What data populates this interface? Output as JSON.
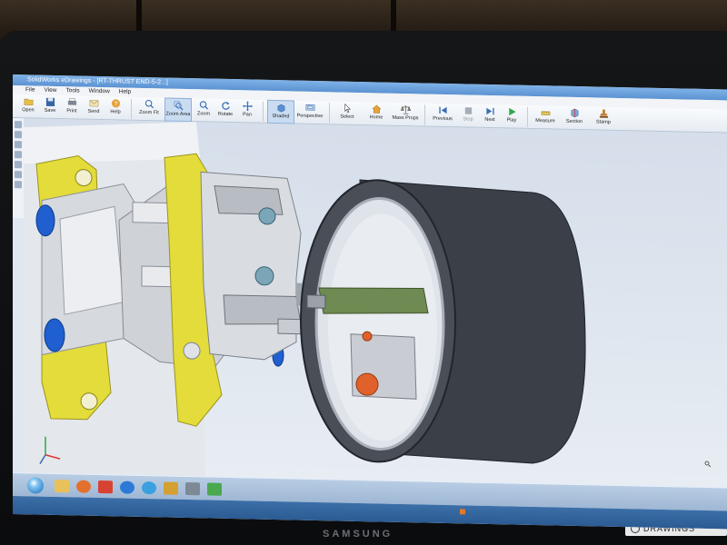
{
  "window": {
    "title": "SolidWorks eDrawings - [RT-THRUST END-5-2...]"
  },
  "menu": {
    "items": [
      "File",
      "View",
      "Tools",
      "Window",
      "Help"
    ]
  },
  "toolbar": {
    "buttons": [
      {
        "label": "Open",
        "icon": "folder-open-icon"
      },
      {
        "label": "Save",
        "icon": "save-icon"
      },
      {
        "label": "Print",
        "icon": "print-icon"
      },
      {
        "label": "Send",
        "icon": "send-icon"
      },
      {
        "label": "Help",
        "icon": "help-icon"
      },
      {
        "label": "Zoom Fit",
        "icon": "zoom-fit-icon"
      },
      {
        "label": "Zoom Area",
        "icon": "zoom-area-icon"
      },
      {
        "label": "Zoom",
        "icon": "zoom-icon"
      },
      {
        "label": "Rotate",
        "icon": "rotate-icon"
      },
      {
        "label": "Pan",
        "icon": "pan-icon"
      },
      {
        "label": "Shaded",
        "icon": "shaded-icon"
      },
      {
        "label": "Perspective",
        "icon": "perspective-icon"
      },
      {
        "label": "Select",
        "icon": "select-arrow-icon"
      },
      {
        "label": "Home",
        "icon": "home-icon"
      },
      {
        "label": "Mass Props",
        "icon": "mass-props-icon"
      },
      {
        "label": "Previous",
        "icon": "previous-icon"
      },
      {
        "label": "Stop",
        "icon": "stop-icon"
      },
      {
        "label": "Next",
        "icon": "next-icon"
      },
      {
        "label": "Play",
        "icon": "play-icon"
      },
      {
        "label": "Measure",
        "icon": "measure-icon"
      },
      {
        "label": "Section",
        "icon": "section-icon"
      },
      {
        "label": "Stamp",
        "icon": "stamp-icon"
      }
    ]
  },
  "monitor": {
    "brand": "SAMSUNG",
    "badge": "DRAWINGS"
  },
  "colors": {
    "yellow_part": "#e3dc3a",
    "blue_part": "#1f5fd0",
    "gray_part": "#d6d9de",
    "wheel": "#3b3f47",
    "green_shaft": "#6f8a52",
    "orange_nut": "#e0612a"
  }
}
